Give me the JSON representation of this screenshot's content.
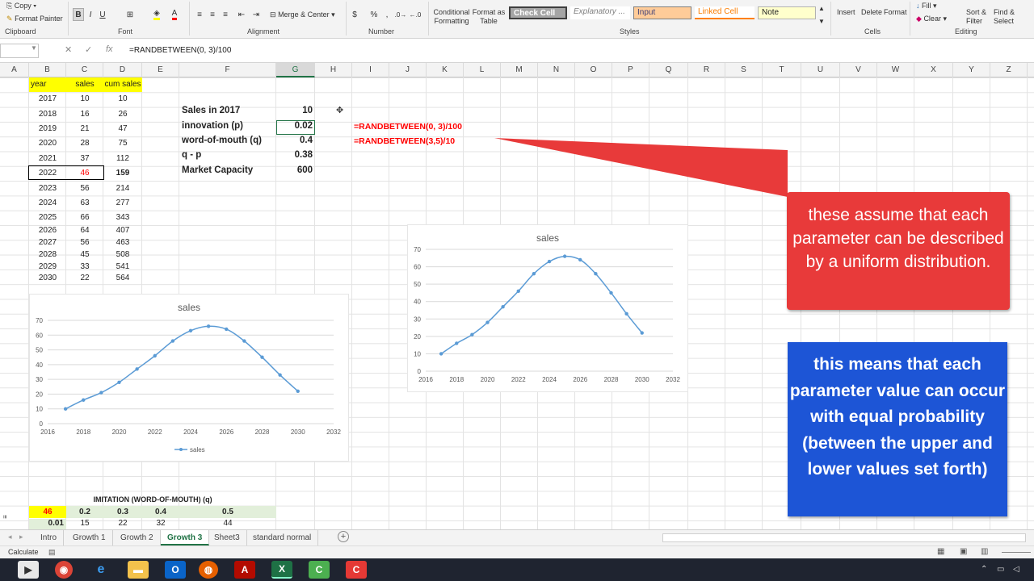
{
  "ribbon": {
    "clipboard": {
      "copy": "Copy",
      "format_painter": "Format Painter",
      "label": "Clipboard"
    },
    "font": {
      "bold": "B",
      "italic": "I",
      "underline": "U",
      "font_color": "A",
      "label": "Font"
    },
    "alignment": {
      "merge_center": "Merge & Center",
      "label": "Alignment"
    },
    "number": {
      "currency": "$",
      "percent": "%",
      "comma": ",",
      "label": "Number"
    },
    "styles": {
      "conditional": "Conditional Formatting",
      "format_table": "Format as Table",
      "check_cell": "Check Cell",
      "explanatory": "Explanatory ...",
      "input": "Input",
      "linked_cell": "Linked Cell",
      "note": "Note",
      "label": "Styles"
    },
    "cells": {
      "insert": "Insert",
      "delete": "Delete",
      "format": "Format",
      "label": "Cells"
    },
    "editing": {
      "fill": "Fill",
      "clear": "Clear",
      "sort_filter": "Sort & Filter",
      "find_select": "Find & Select",
      "label": "Editing"
    }
  },
  "formula_bar": {
    "name_box": "",
    "cancel": "✕",
    "enter": "✓",
    "fx": "fx",
    "formula": "=RANDBETWEEN(0, 3)/100"
  },
  "columns": [
    "A",
    "B",
    "C",
    "D",
    "E",
    "F",
    "G",
    "H",
    "I",
    "J",
    "K",
    "L",
    "M",
    "N",
    "O",
    "P",
    "Q",
    "R",
    "S",
    "T",
    "U",
    "V",
    "W",
    "X",
    "Y",
    "Z"
  ],
  "table": {
    "headers": [
      "year",
      "sales",
      "cum sales"
    ],
    "rows": [
      [
        "2017",
        "10",
        "10"
      ],
      [
        "2018",
        "16",
        "26"
      ],
      [
        "2019",
        "21",
        "47"
      ],
      [
        "2020",
        "28",
        "75"
      ],
      [
        "2021",
        "37",
        "112"
      ],
      [
        "2022",
        "46",
        "159"
      ],
      [
        "2023",
        "56",
        "214"
      ],
      [
        "2024",
        "63",
        "277"
      ],
      [
        "2025",
        "66",
        "343"
      ],
      [
        "2026",
        "64",
        "407"
      ],
      [
        "2027",
        "56",
        "463"
      ],
      [
        "2028",
        "45",
        "508"
      ],
      [
        "2029",
        "33",
        "541"
      ],
      [
        "2030",
        "22",
        "564"
      ]
    ]
  },
  "params": [
    {
      "label": "Sales in 2017",
      "value": "10"
    },
    {
      "label": "innovation (p)",
      "value": "0.02",
      "formula": "=RANDBETWEEN(0, 3)/100"
    },
    {
      "label": "word-of-mouth (q)",
      "value": "0.4",
      "formula": "=RANDBETWEEN(3,5)/10"
    },
    {
      "label": "q - p",
      "value": "0.38"
    },
    {
      "label": "Market Capacity",
      "value": "600"
    }
  ],
  "imitation": {
    "title": "IMITATION (WORD-OF-MOUTH) (q)",
    "corner": "46",
    "header_values": [
      "0.2",
      "0.3",
      "0.4",
      "0.5"
    ],
    "row_label": "0.01",
    "row_values": [
      "15",
      "22",
      "32",
      "44"
    ]
  },
  "chart_data": [
    {
      "type": "line",
      "title": "sales",
      "x": [
        2017,
        2018,
        2019,
        2020,
        2021,
        2022,
        2023,
        2024,
        2025,
        2026,
        2027,
        2028,
        2029,
        2030
      ],
      "series": [
        {
          "name": "sales",
          "values": [
            10,
            16,
            21,
            28,
            37,
            46,
            56,
            63,
            66,
            64,
            56,
            45,
            33,
            22
          ]
        }
      ],
      "xlim": [
        2016,
        2032
      ],
      "ylim": [
        0,
        70
      ],
      "xticks": [
        "2016",
        "2018",
        "2020",
        "2022",
        "2024",
        "2026",
        "2028",
        "2030",
        "2032"
      ],
      "yticks": [
        "0",
        "10",
        "20",
        "30",
        "40",
        "50",
        "60",
        "70"
      ],
      "legend": "bottom",
      "color": "#5b9bd5"
    },
    {
      "type": "line",
      "title": "sales",
      "x": [
        2017,
        2018,
        2019,
        2020,
        2021,
        2022,
        2023,
        2024,
        2025,
        2026,
        2027,
        2028,
        2029,
        2030
      ],
      "series": [
        {
          "values": [
            10,
            16,
            21,
            28,
            37,
            46,
            56,
            63,
            66,
            64,
            56,
            45,
            33,
            22
          ]
        }
      ],
      "xlim": [
        2016,
        2032
      ],
      "ylim": [
        0,
        70
      ],
      "xticks": [
        "2016",
        "2018",
        "2020",
        "2022",
        "2024",
        "2026",
        "2028",
        "2030",
        "2032"
      ],
      "yticks": [
        "0",
        "10",
        "20",
        "30",
        "40",
        "50",
        "60",
        "70"
      ],
      "legend": "none",
      "color": "#5b9bd5"
    }
  ],
  "callouts": {
    "red": "these assume that each parameter can be described by a uniform distribution.",
    "blue": "this means that each parameter value can occur with equal probability (between the upper and lower values set forth)"
  },
  "tabs": [
    "Intro",
    "Growth 1",
    "Growth 2",
    "Growth 3",
    "Sheet3",
    "standard normal"
  ],
  "active_tab": "Growth 3",
  "status": "Calculate",
  "colors": {
    "excel_green": "#217346",
    "red_callout": "#e83a3a",
    "blue_callout": "#1d55d6",
    "header_yellow": "#ffff00",
    "formula_red": "#ff0000"
  }
}
